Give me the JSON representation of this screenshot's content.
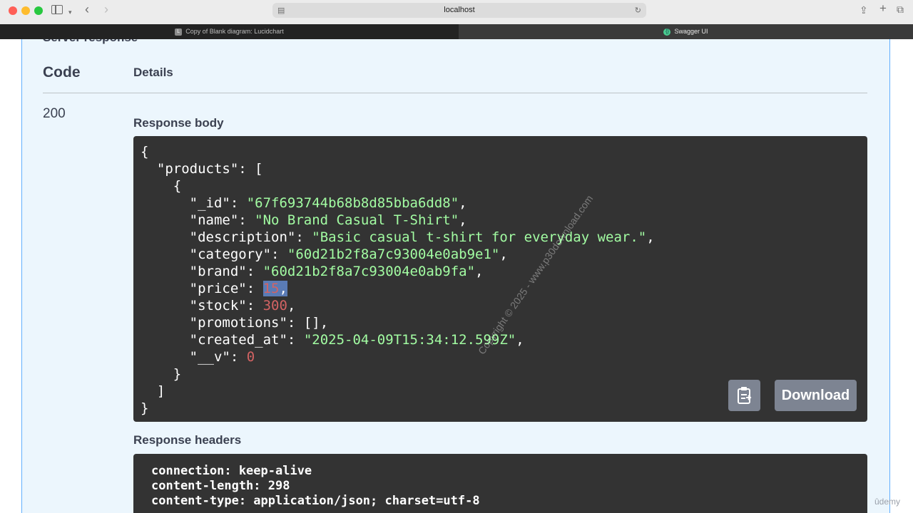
{
  "browser": {
    "url": "localhost",
    "tabs": [
      {
        "label": "Copy of Blank diagram: Lucidchart",
        "favicon": "L"
      },
      {
        "label": "Swagger UI"
      }
    ]
  },
  "response": {
    "section_title": "Server response",
    "columns": {
      "code": "Code",
      "details": "Details"
    },
    "status_code": "200",
    "body_title": "Response body",
    "body": {
      "l1": "{",
      "l2_key": "\"products\"",
      "l2_rest": ": [",
      "l3": "{",
      "id_key": "\"_id\"",
      "id_val": "\"67f693744b68b8d85bba6dd8\"",
      "name_key": "\"name\"",
      "name_val": "\"No Brand Casual T-Shirt\"",
      "desc_key": "\"description\"",
      "desc_val": "\"Basic casual t-shirt for everyday wear.\"",
      "cat_key": "\"category\"",
      "cat_val": "\"60d21b2f8a7c93004e0ab9e1\"",
      "brand_key": "\"brand\"",
      "brand_val": "\"60d21b2f8a7c93004e0ab9fa\"",
      "price_key": "\"price\"",
      "price_val": "15",
      "stock_key": "\"stock\"",
      "stock_val": "300",
      "promo_key": "\"promotions\"",
      "promo_val": "[]",
      "created_key": "\"created_at\"",
      "created_val": "\"2025-04-09T15:34:12.599Z\"",
      "v_key": "\"__v\"",
      "v_val": "0",
      "close_obj": "}",
      "close_arr": "]",
      "close_root": "}"
    },
    "download_label": "Download",
    "watermark": "Copyright © 2025 - www.p30download.com",
    "headers_title": "Response headers",
    "headers": {
      "h1": "connection: keep-alive",
      "h2": "content-length: 298",
      "h3": "content-type: application/json; charset=utf-8"
    }
  },
  "overlay": {
    "brand": "ûdemy"
  },
  "colors": {
    "panel_bg": "#ecf6fd",
    "panel_border": "#61affe",
    "code_bg": "#333333",
    "string": "#a2fca2",
    "number": "#d36363",
    "button": "#7d8492"
  }
}
